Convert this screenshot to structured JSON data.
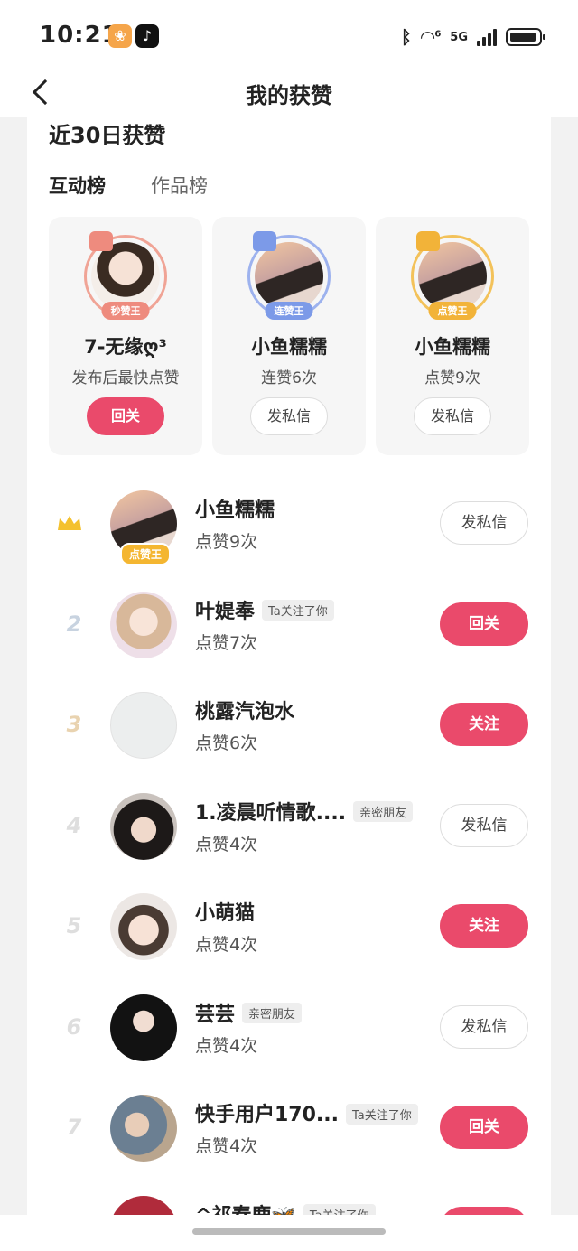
{
  "status_bar": {
    "time": "10:21",
    "network": "5G",
    "wifi_badge": "6",
    "icons": [
      "bluetooth-icon",
      "wifi-icon",
      "signal-icon",
      "battery-icon"
    ]
  },
  "header": {
    "title": "我的获赞",
    "back_icon": "chevron-left-icon"
  },
  "section": {
    "title": "近30日获赞",
    "tabs": [
      {
        "label": "互动榜",
        "active": true
      },
      {
        "label": "作品榜",
        "active": false
      }
    ]
  },
  "top3": [
    {
      "badge": "秒赞王",
      "name": "7-无缘ღ³",
      "desc": "发布后最快点赞",
      "button": "回关",
      "badge_color": "#ee8b7e",
      "ring_color": "#f0a496"
    },
    {
      "badge": "连赞王",
      "name": "小鱼糯糯",
      "desc": "连赞6次",
      "button": "发私信",
      "badge_color": "#7c9ae8",
      "ring_color": "#9db2ee"
    },
    {
      "badge": "点赞王",
      "name": "小鱼糯糯",
      "desc": "点赞9次",
      "button": "发私信",
      "badge_color": "#f2b339",
      "ring_color": "#f3c25a"
    }
  ],
  "ranking": [
    {
      "rank": "",
      "crown": true,
      "name": "小鱼糯糯",
      "tag": "",
      "count": "点赞9次",
      "button": "发私信",
      "primary": false,
      "badge": "点赞王"
    },
    {
      "rank": "2",
      "name": "叶媞奉",
      "tag": "Ta关注了你",
      "count": "点赞7次",
      "button": "回关",
      "primary": true
    },
    {
      "rank": "3",
      "name": "桃露汽泡水",
      "tag": "",
      "count": "点赞6次",
      "button": "关注",
      "primary": true
    },
    {
      "rank": "4",
      "name": "1.凌晨听情歌....",
      "tag": "亲密朋友",
      "count": "点赞4次",
      "button": "发私信",
      "primary": false
    },
    {
      "rank": "5",
      "name": "小萌猫",
      "tag": "",
      "count": "点赞4次",
      "button": "关注",
      "primary": true
    },
    {
      "rank": "6",
      "name": "芸芸",
      "tag": "亲密朋友",
      "count": "点赞4次",
      "button": "发私信",
      "primary": false
    },
    {
      "rank": "7",
      "name": "快手用户170...",
      "tag": "Ta关注了你",
      "count": "点赞4次",
      "button": "回关",
      "primary": true
    },
    {
      "rank": "",
      "name": "^祁春鹿🦋",
      "tag": "Ta关注了你",
      "count": "",
      "button": "",
      "primary": true
    }
  ],
  "colors": {
    "accent": "#ea4a6b",
    "rank_2": "#c8d3e0",
    "rank_3": "#e9d3b0",
    "rank_other": "#dedede",
    "crown": "#f4c12e"
  }
}
